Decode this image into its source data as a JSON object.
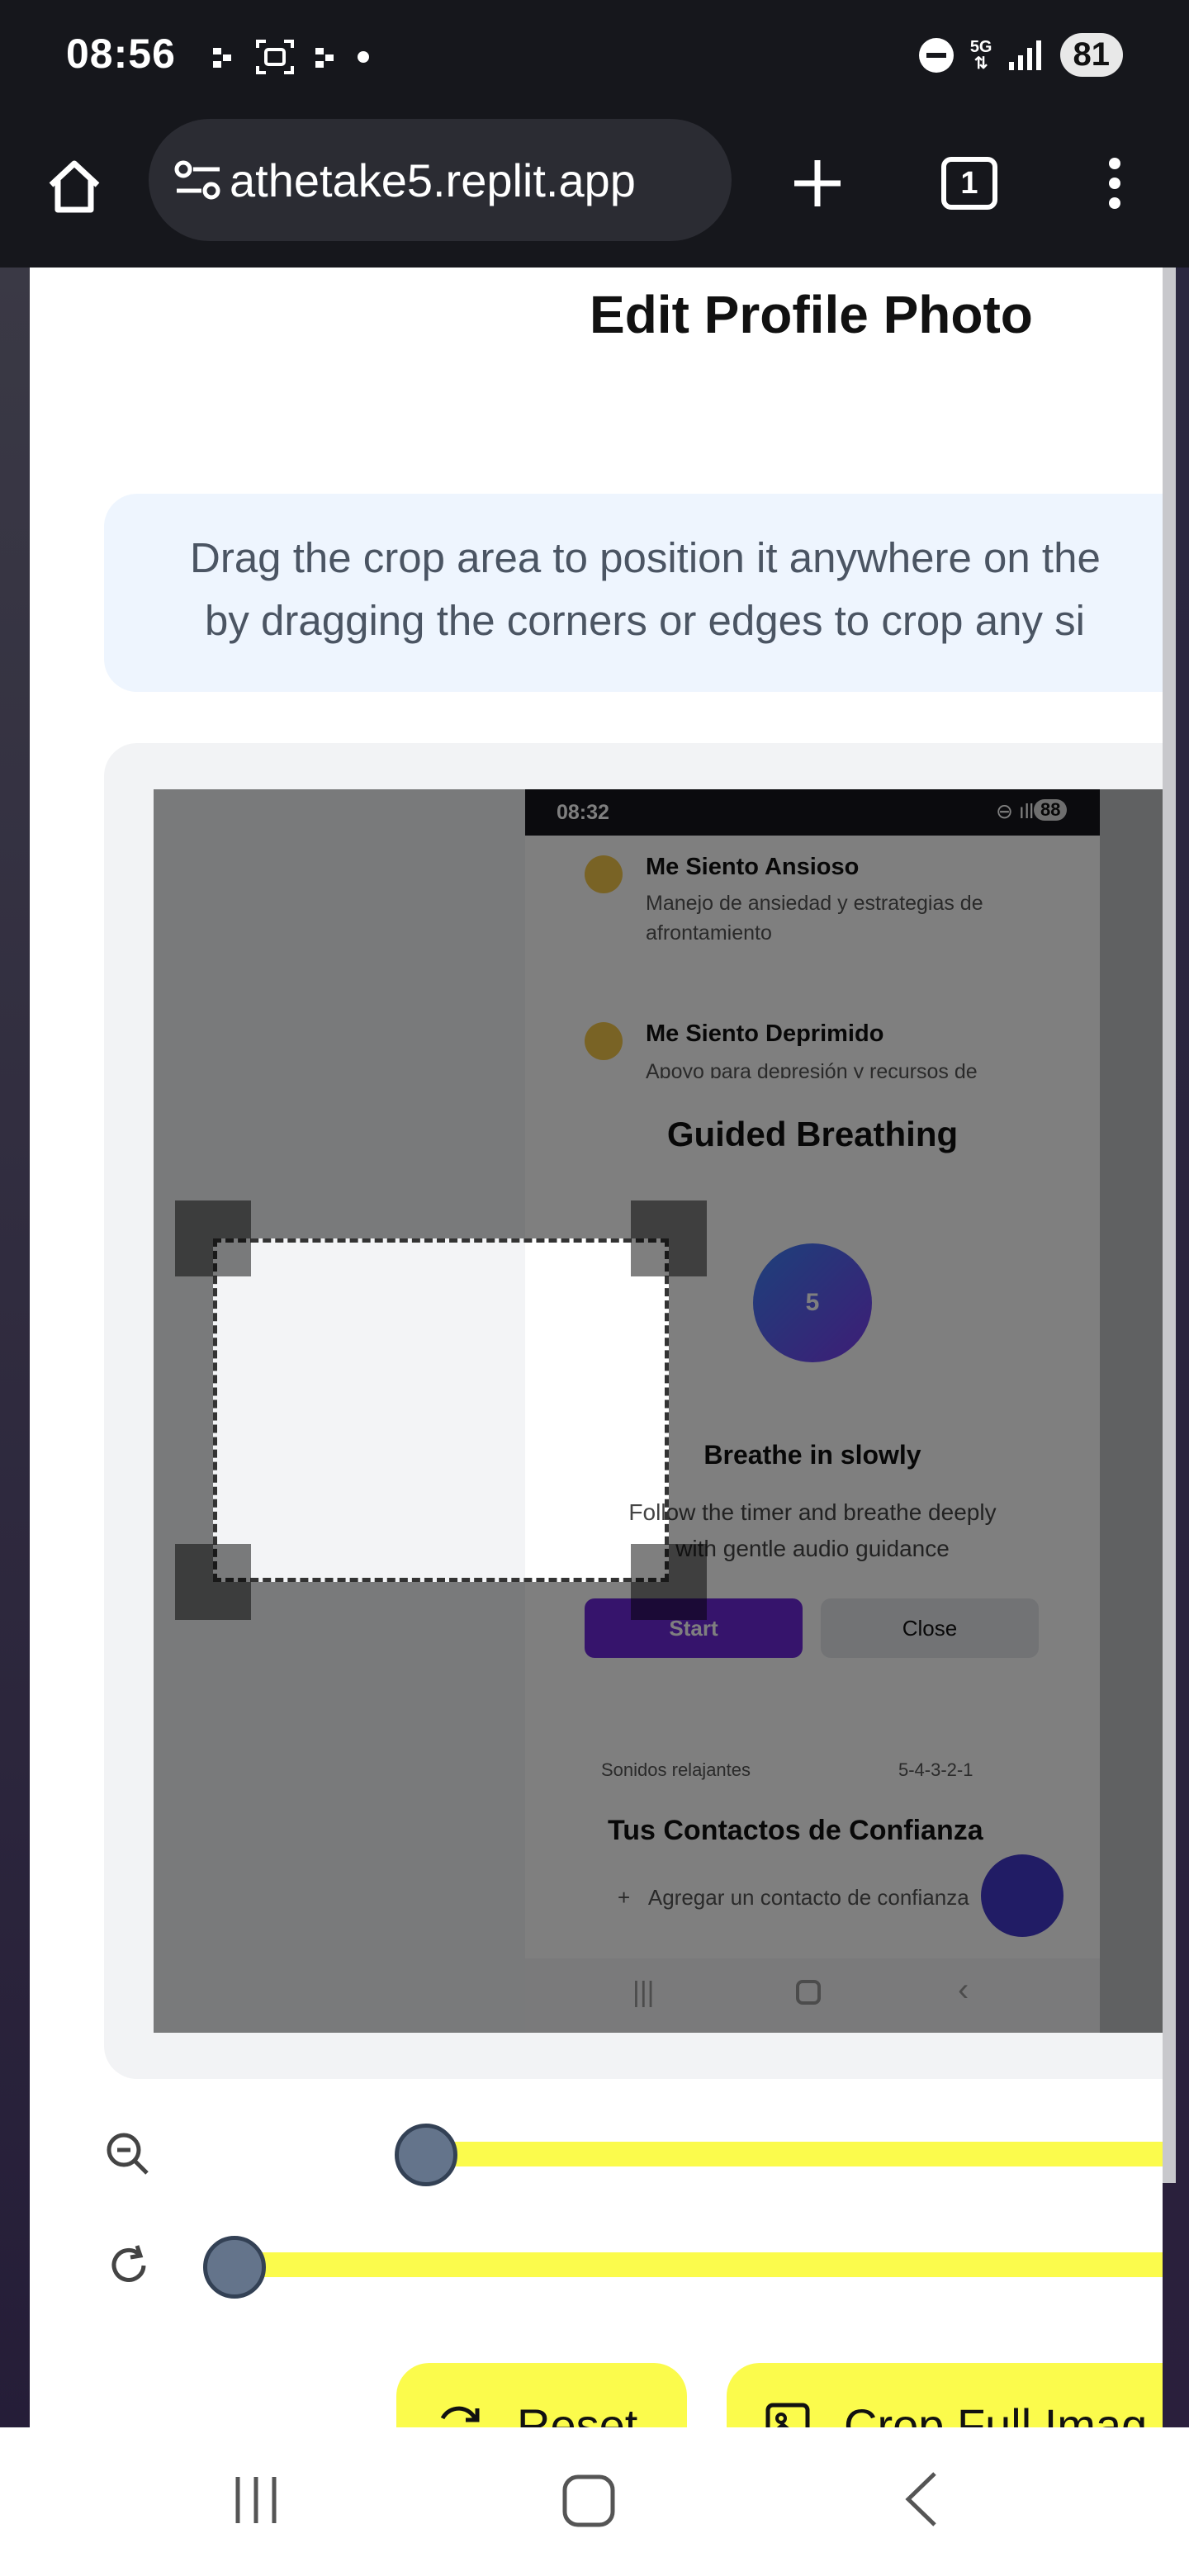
{
  "status_bar": {
    "time": "08:56",
    "network": "5G",
    "battery": "81"
  },
  "browser": {
    "url": "athetake5.replit.app",
    "tab_count": "1"
  },
  "dialog": {
    "title": "Edit Profile Photo",
    "info_line_1": "Drag the crop area to position it anywhere on the",
    "info_line_2": "by dragging the corners or edges to crop any si"
  },
  "inner_screenshot": {
    "status_time": "08:32",
    "battery": "88",
    "items": [
      {
        "title": "Me Siento Ansioso",
        "subtitle": "Manejo de ansiedad y estrategias de afrontamiento"
      },
      {
        "title": "Me Siento Deprimido",
        "subtitle": "Apoyo para depresión y recursos de"
      }
    ],
    "modal": {
      "title": "Guided Breathing",
      "counter": "5",
      "instruction": "Breathe in slowly",
      "description_1": "Follow the timer and breathe deeply",
      "description_2": "with gentle audio guidance",
      "start_label": "Start",
      "close_label": "Close"
    },
    "row_left": "Sonidos relajantes",
    "row_right": "5-4-3-2-1",
    "contacts_title": "Tus Contactos de Confianza",
    "add_contact": "Agregar un contacto de confianza"
  },
  "controls": {
    "zoom_level": 0.0,
    "rotation_level": 0.0,
    "reset_label": "Reset",
    "crop_full_label": "Crop Full Imag"
  },
  "colors": {
    "accent_yellow": "#fbfb4c",
    "info_bg": "#eef5fe",
    "slider_thumb": "#64748b",
    "start_purple": "#6d28d9"
  }
}
